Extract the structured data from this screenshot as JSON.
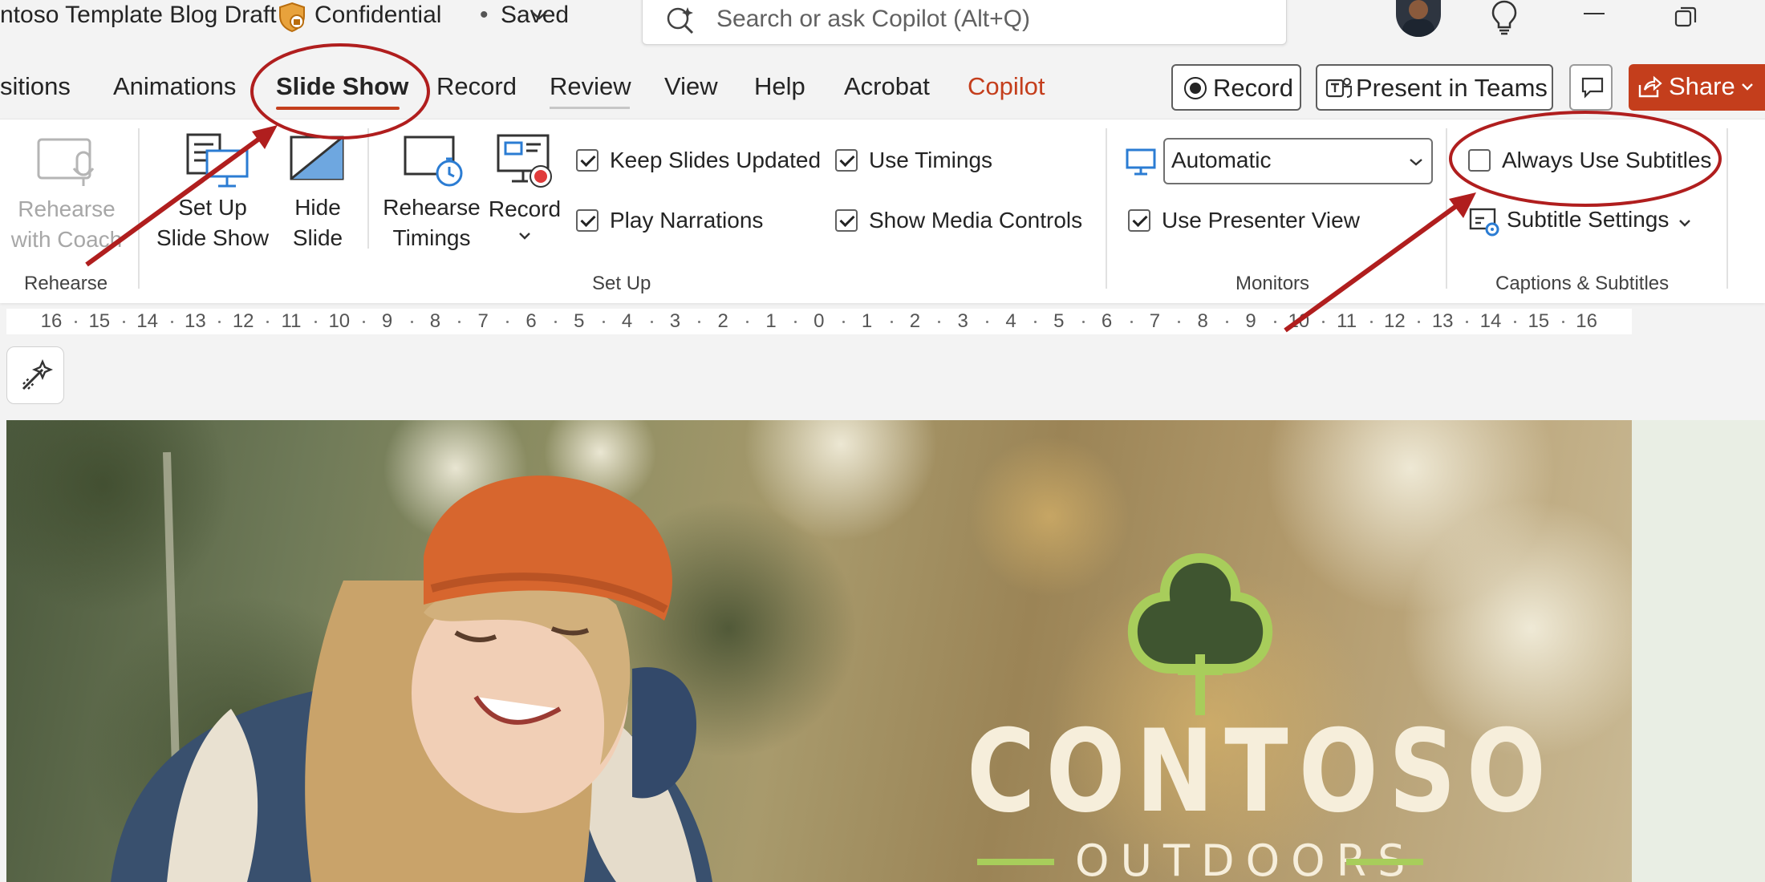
{
  "titlebar": {
    "document_title": "ntoso Template Blog Draft",
    "sensitivity_label": "Confidential",
    "separator": "•",
    "save_status": "Saved",
    "search_placeholder": "Search or ask Copilot (Alt+Q)"
  },
  "tabs": [
    {
      "label": "sitions"
    },
    {
      "label": "Animations"
    },
    {
      "label": "Slide Show",
      "active": true
    },
    {
      "label": "Record"
    },
    {
      "label": "Review"
    },
    {
      "label": "View"
    },
    {
      "label": "Help"
    },
    {
      "label": "Acrobat"
    },
    {
      "label": "Copilot"
    }
  ],
  "header_buttons": {
    "record": "Record",
    "present_in_teams": "Present in Teams",
    "share": "Share"
  },
  "ribbon": {
    "rehearse": {
      "coach_line1": "Rehearse",
      "coach_line2": "with Coach",
      "group": "Rehearse"
    },
    "setup": {
      "setup_line1": "Set Up",
      "setup_line2": "Slide Show",
      "hide_line1": "Hide",
      "hide_line2": "Slide",
      "timings_line1": "Rehearse",
      "timings_line2": "Timings",
      "record": "Record",
      "keep_updated": "Keep Slides Updated",
      "play_narrations": "Play Narrations",
      "use_timings": "Use Timings",
      "show_media_controls": "Show Media Controls",
      "group": "Set Up"
    },
    "monitors": {
      "selected": "Automatic",
      "presenter_view": "Use Presenter View",
      "group": "Monitors"
    },
    "captions": {
      "always_subtitles": "Always Use Subtitles",
      "subtitle_settings": "Subtitle Settings",
      "group": "Captions & Subtitles"
    }
  },
  "ruler": {
    "labels": [
      "16",
      "15",
      "14",
      "13",
      "12",
      "11",
      "10",
      "9",
      "8",
      "7",
      "6",
      "5",
      "4",
      "3",
      "2",
      "1",
      "0",
      "1",
      "2",
      "3",
      "4",
      "5",
      "6",
      "7",
      "8",
      "9",
      "10",
      "11",
      "12",
      "13",
      "14",
      "15",
      "16"
    ]
  },
  "slide": {
    "brand_name": "CONTOSO",
    "brand_sub": "OUTDOORS"
  },
  "colors": {
    "accent": "#c43e1c",
    "annotation": "#b01e1e",
    "logo_green": "#a8cd5b",
    "logo_dark": "#3f5530"
  }
}
